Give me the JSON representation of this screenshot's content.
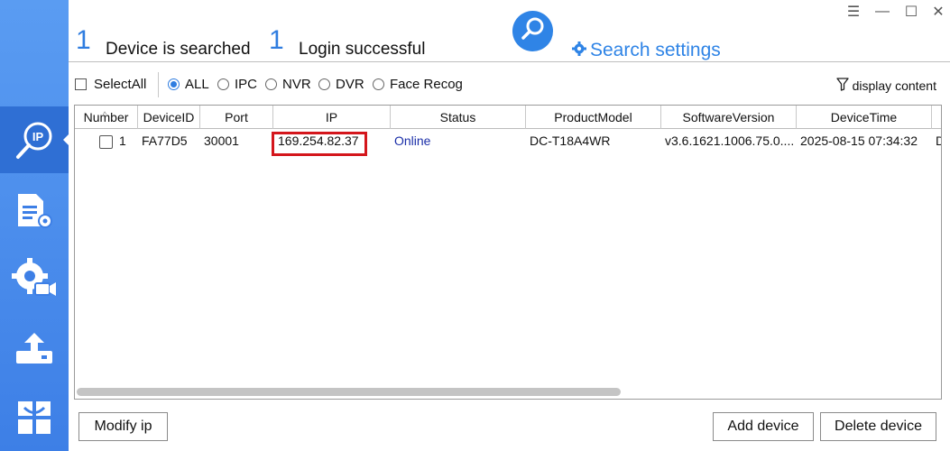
{
  "header": {
    "searched_count": "1",
    "searched_label": "Device is searched",
    "login_count": "1",
    "login_label": "Login successful",
    "search_settings_label": "Search settings"
  },
  "window_controls": {
    "menu": "☰",
    "minimize": "—",
    "maximize": "☐",
    "close": "✕"
  },
  "sidebar": {
    "items": [
      {
        "icon": "ip-search-icon",
        "active": true
      },
      {
        "icon": "document-settings-icon",
        "active": false
      },
      {
        "icon": "camera-settings-icon",
        "active": false
      },
      {
        "icon": "upload-icon",
        "active": false
      },
      {
        "icon": "app-grid-icon",
        "active": false
      }
    ]
  },
  "filters": {
    "select_all": "SelectAll",
    "options": [
      "ALL",
      "IPC",
      "NVR",
      "DVR",
      "Face Recog"
    ],
    "selected": "ALL",
    "display_content": "display content"
  },
  "table": {
    "columns": [
      "Number",
      "DeviceID",
      "Port",
      "IP",
      "Status",
      "ProductModel",
      "SoftwareVersion",
      "DeviceTime",
      ""
    ],
    "rows": [
      {
        "number": "1",
        "device_id": "FA77D5",
        "port": "30001",
        "ip": "169.254.82.37",
        "status": "Online",
        "product_model": "DC-T18A4WR",
        "software_version": "v3.6.1621.1006.75.0....",
        "device_time": "2025-08-15 07:34:32",
        "extra": "D"
      }
    ]
  },
  "buttons": {
    "modify_ip": "Modify ip",
    "add_device": "Add device",
    "delete_device": "Delete device"
  },
  "colors": {
    "sidebar": "#3d7fe6",
    "accent": "#2f84e6",
    "online": "#1a2ea8",
    "highlight": "#d4161c"
  }
}
